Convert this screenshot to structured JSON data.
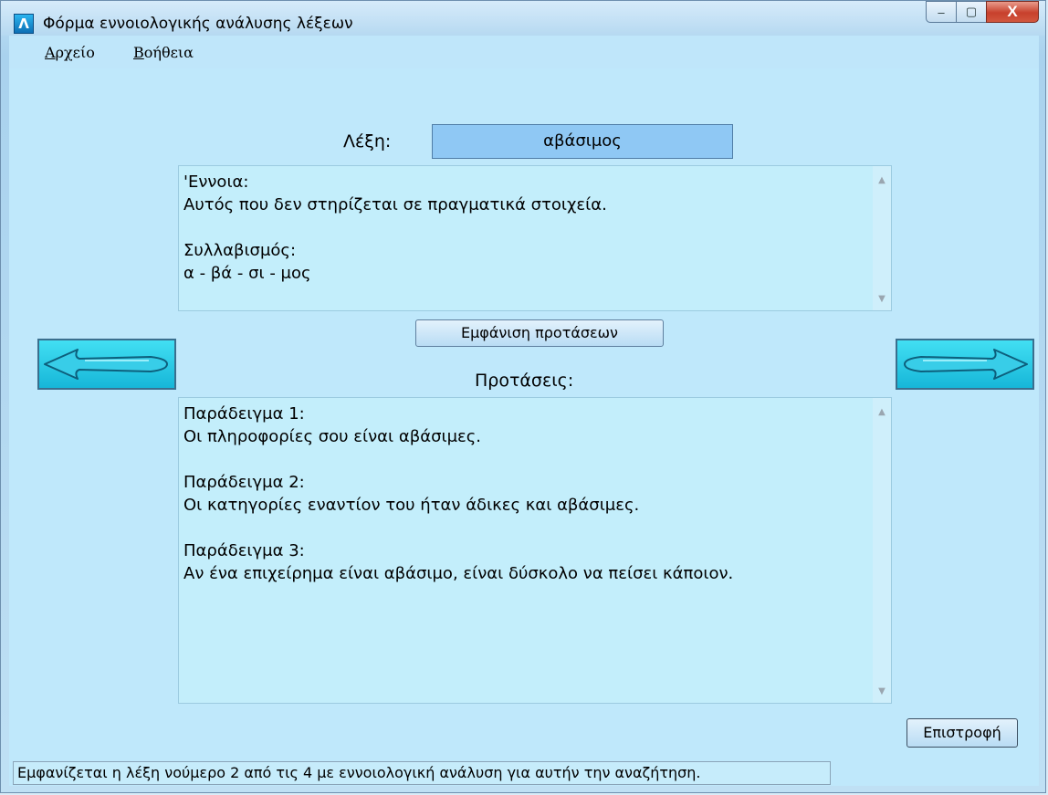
{
  "window": {
    "title": "Φόρμα εννοιολογικής ανάλυσης λέξεων",
    "app_icon_glyph": "Λ",
    "caption_buttons": {
      "minimize": "‒",
      "maximize": "▢",
      "close": "X"
    }
  },
  "menu": {
    "items": [
      {
        "label": "Αρχείο"
      },
      {
        "label": "Βοήθεια"
      }
    ]
  },
  "word": {
    "label": "Λέξη:",
    "value": "αβάσιμος"
  },
  "meaning_pane": {
    "text": "'Εννοια:\nΑυτός που δεν στηρίζεται σε πραγματικά στοιχεία.\n\nΣυλλαβισμός:\nα - βά - σι - μος"
  },
  "show_sentences_button": "Εμφάνιση προτάσεων",
  "sentences_label": "Προτάσεις:",
  "sentences_pane": {
    "text": "Παράδειγμα 1:\nΟι πληροφορίες σου είναι αβάσιμες.\n\nΠαράδειγμα 2:\nΟι κατηγορίες εναντίον του ήταν άδικες και αβάσιμες.\n\nΠαράδειγμα 3:\nΑν ένα επιχείρημα είναι αβάσιμο, είναι δύσκολο να πείσει κάποιον."
  },
  "nav": {
    "prev_icon": "arrow-left-icon",
    "next_icon": "arrow-right-icon"
  },
  "back_button": "Επιστροφή",
  "status": "Εμφανίζεται η λέξη νούμερο 2 από τις 4 με εννοιολογική ανάλυση για αυτήν την αναζήτηση.",
  "colors": {
    "client_bg": "#bfe8fb",
    "pane_bg": "#c3eefb",
    "word_box_bg": "#8fc8f4",
    "arrow_button": "#24c8e6"
  }
}
